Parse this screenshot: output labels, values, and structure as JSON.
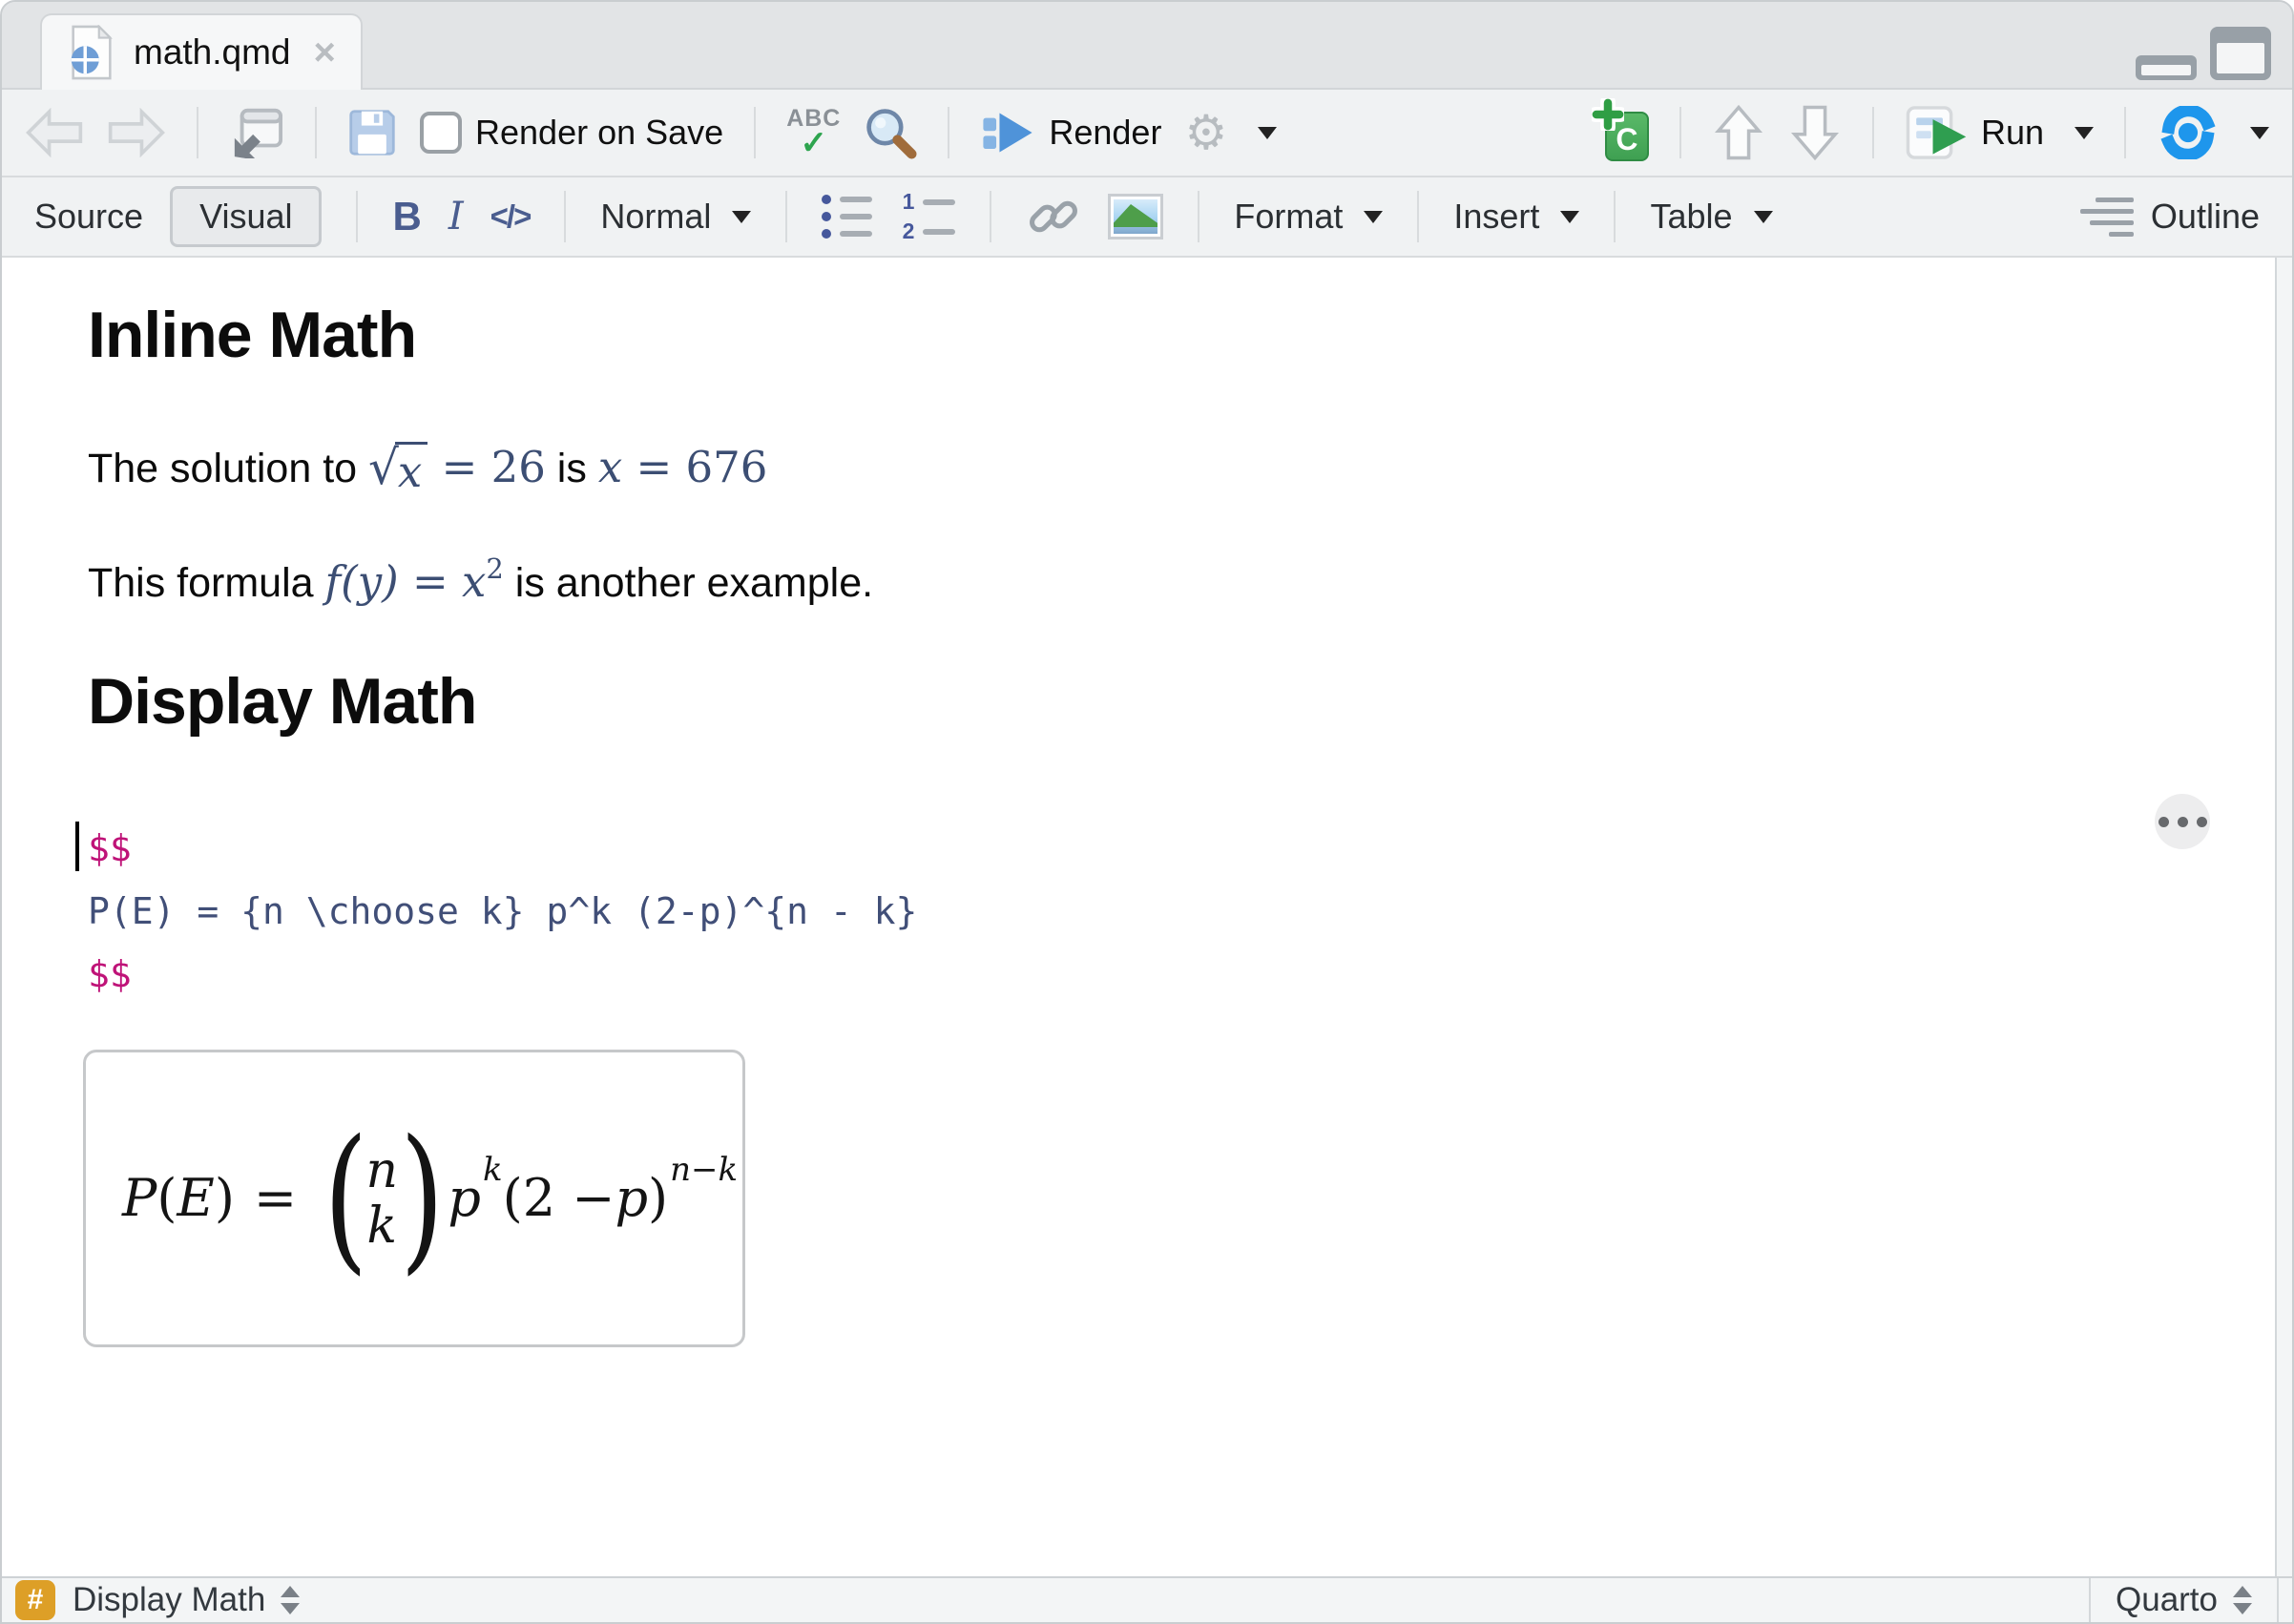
{
  "tab": {
    "title": "math.qmd",
    "close_glyph": "×"
  },
  "toolbar": {
    "render_on_save": "Render on Save",
    "render": "Render",
    "run": "Run",
    "gear_glyph": "⚙"
  },
  "formatbar": {
    "source": "Source",
    "visual": "Visual",
    "bold": "B",
    "italic": "I",
    "code_glyph": "</>",
    "style": "Normal",
    "format": "Format",
    "insert": "Insert",
    "table": "Table",
    "outline": "Outline"
  },
  "doc": {
    "h1": "Inline Math",
    "p1_before": "The solution to ",
    "p1_sqrt_arg": "x",
    "p1_eq": " = 26",
    "p1_mid": " is ",
    "p1_var": "x",
    "p1_eq2": " = 676",
    "p2_before": "This formula ",
    "p2_math": "f(y) = x",
    "p2_sup": "2",
    "p2_after": " is another example.",
    "h2": "Display Math",
    "code": {
      "open": "$$",
      "line": "P(E) = {n \\choose k} p^k (2-p)^{n - k}",
      "close": "$$"
    },
    "preview": {
      "lhs_P": "P",
      "lhs_po": "(",
      "lhs_E": "E",
      "lhs_pc": ")",
      "equals": "=",
      "paren_open": "(",
      "binom_top": "n",
      "binom_bottom": "k",
      "paren_close": ")",
      "base": "p",
      "sup1": "k",
      "factor_open": "(",
      "factor_num": "2 − ",
      "factor_var": "p",
      "factor_close": ")",
      "sup2": "n−k"
    }
  },
  "statusbar": {
    "hash": "#",
    "block": "Display Math",
    "mode": "Quarto"
  },
  "colors": {
    "dollar_magenta": "#bf1378",
    "code_blue": "#414f78",
    "math_blue": "#3c4e73",
    "hash_orange": "#dd9f27",
    "run_green": "#2f9e50",
    "render_blue": "#4f93d9",
    "cycle_blue": "#1e96ec"
  }
}
